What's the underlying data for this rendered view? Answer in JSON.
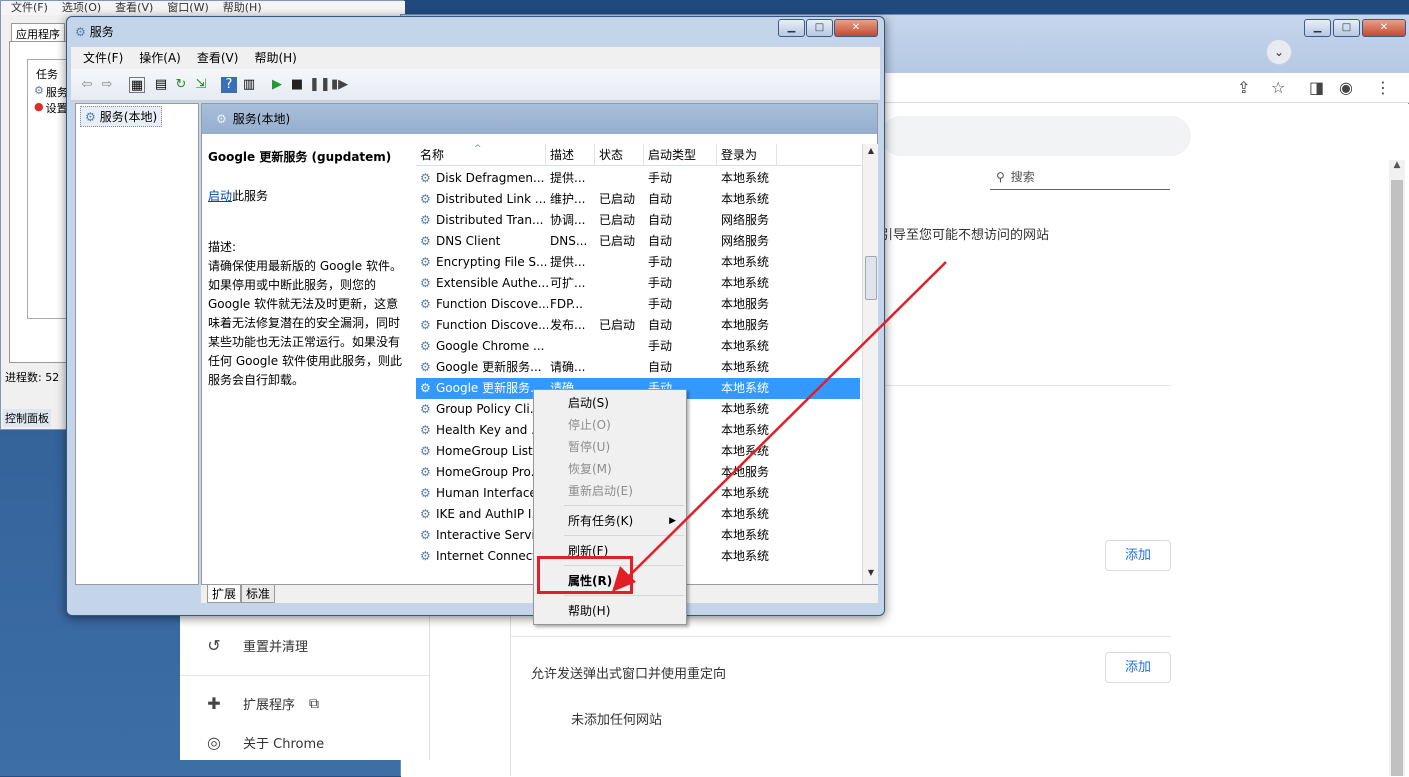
{
  "taskmgr": {
    "menu": [
      "文件(F)",
      "选项(O)",
      "查看(V)",
      "窗口(W)",
      "帮助(H)"
    ],
    "tab": "应用程序",
    "list_header": "任务",
    "list_items": [
      "服务",
      "设置"
    ],
    "status": "进程数: 52",
    "control_panel": "控制面板"
  },
  "chrome": {
    "search_placeholder": "搜索",
    "warning_fragment": "引导至您可能不想访问的网站",
    "add_label_1": "添加",
    "add_label_2": "添加",
    "popup_redirect": "允许发送弹出式窗口并使用重定向",
    "no_sites": "未添加任何网站",
    "sidebar": [
      {
        "label": "重置并清理",
        "icon": "history-icon"
      },
      {
        "label": "扩展程序",
        "icon": "puzzle-icon"
      },
      {
        "label": "关于 Chrome",
        "icon": "chrome-icon"
      }
    ]
  },
  "services": {
    "title": "服务",
    "menu": [
      "文件(F)",
      "操作(A)",
      "查看(V)",
      "帮助(H)"
    ],
    "tree_item": "服务(本地)",
    "header": "服务(本地)",
    "desc": {
      "title": "Google 更新服务 (gupdatem)",
      "start_link": "启动",
      "start_rest": "此服务",
      "desc_label": "描述:",
      "desc_text": "请确保使用最新版的 Google 软件。如果停用或中断此服务，则您的 Google 软件就无法及时更新，这意味着无法修复潜在的安全漏洞，同时某些功能也无法正常运行。如果没有任何 Google 软件使用此服务，则此服务会自行卸载。"
    },
    "columns": [
      "名称",
      "描述",
      "状态",
      "启动类型",
      "登录为"
    ],
    "rows": [
      [
        "Disk Defragmen...",
        "提供...",
        "",
        "手动",
        "本地系统"
      ],
      [
        "Distributed Link ...",
        "维护...",
        "已启动",
        "自动",
        "本地系统"
      ],
      [
        "Distributed Tran...",
        "协调...",
        "已启动",
        "自动",
        "网络服务"
      ],
      [
        "DNS Client",
        "DNS...",
        "已启动",
        "自动",
        "网络服务"
      ],
      [
        "Encrypting File S...",
        "提供...",
        "",
        "手动",
        "本地系统"
      ],
      [
        "Extensible Authe...",
        "可扩...",
        "",
        "手动",
        "本地系统"
      ],
      [
        "Function Discove...",
        "FDP...",
        "",
        "手动",
        "本地服务"
      ],
      [
        "Function Discove...",
        "发布...",
        "已启动",
        "自动",
        "本地服务"
      ],
      [
        "Google Chrome ...",
        "",
        "",
        "手动",
        "本地系统"
      ],
      [
        "Google 更新服务...",
        "请确...",
        "",
        "自动",
        "本地系统"
      ],
      [
        "Google 更新服务...",
        "请确...",
        "",
        "手动",
        "本地系统"
      ],
      [
        "Group Policy Cli...",
        "",
        "",
        "",
        "本地系统"
      ],
      [
        "Health Key and ...",
        "",
        "",
        "",
        "本地系统"
      ],
      [
        "HomeGroup List...",
        "",
        "",
        "",
        "本地系统"
      ],
      [
        "HomeGroup Pro...",
        "",
        "",
        "",
        "本地服务"
      ],
      [
        "Human Interface...",
        "",
        "",
        "",
        "本地系统"
      ],
      [
        "IKE and AuthIP I...",
        "",
        "",
        "",
        "本地系统"
      ],
      [
        "Interactive Servi...",
        "",
        "",
        "",
        "本地系统"
      ],
      [
        "Internet Connect...",
        "",
        "",
        "",
        "本地系统"
      ]
    ],
    "selected_row": 10,
    "tabs": [
      "扩展",
      "标准"
    ]
  },
  "context_menu": {
    "items": [
      {
        "label": "启动(S)",
        "disabled": false
      },
      {
        "label": "停止(O)",
        "disabled": true
      },
      {
        "label": "暂停(U)",
        "disabled": true
      },
      {
        "label": "恢复(M)",
        "disabled": true
      },
      {
        "label": "重新启动(E)",
        "disabled": true
      },
      {
        "label": "所有任务(K)",
        "disabled": false
      },
      {
        "label": "刷新(F)",
        "disabled": false
      },
      {
        "label": "属性(R)",
        "disabled": false
      },
      {
        "label": "帮助(H)",
        "disabled": false
      }
    ]
  },
  "colors": {
    "highlight": "#e21f26",
    "selection": "#3399ff"
  }
}
